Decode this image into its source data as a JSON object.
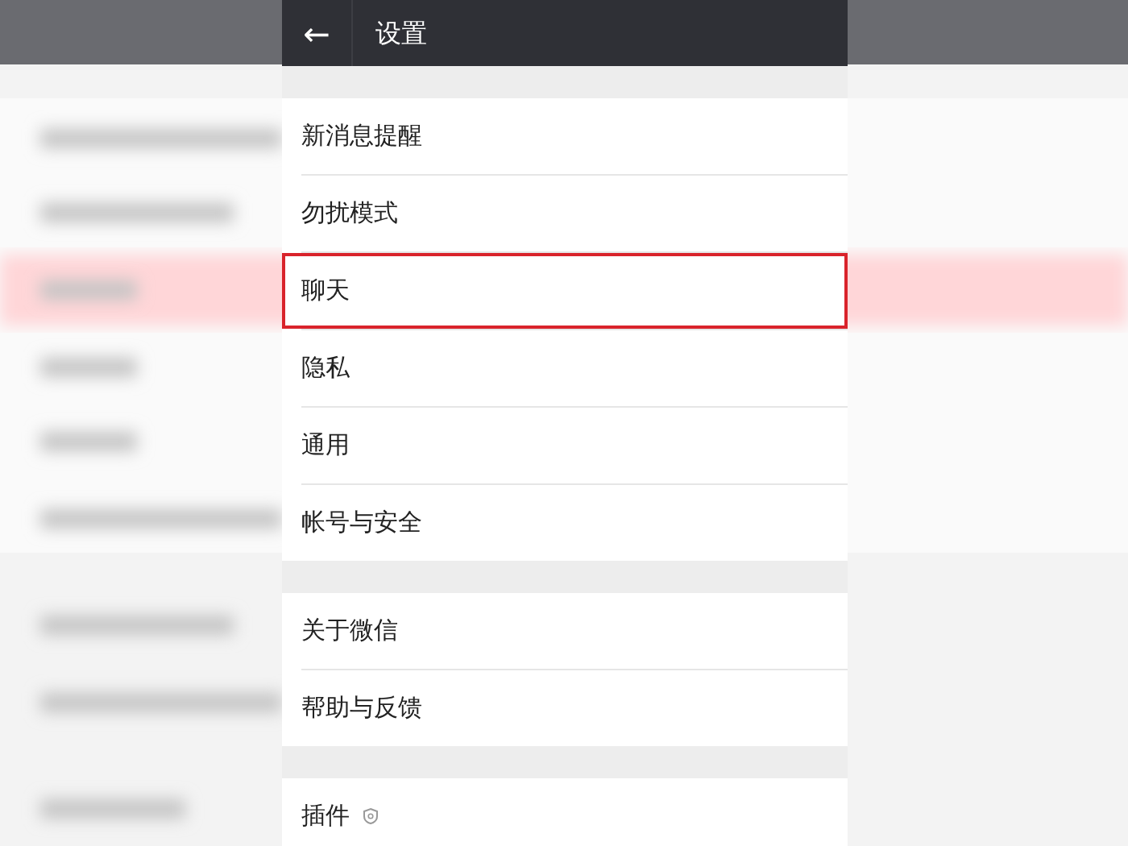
{
  "header": {
    "back": "←",
    "title": "设置"
  },
  "groups": [
    {
      "items": [
        {
          "label": "新消息提醒",
          "kind": "plain",
          "highlighted": false
        },
        {
          "label": "勿扰模式",
          "kind": "plain",
          "highlighted": false
        },
        {
          "label": "聊天",
          "kind": "plain",
          "highlighted": true
        },
        {
          "label": "隐私",
          "kind": "plain",
          "highlighted": false
        },
        {
          "label": "通用",
          "kind": "plain",
          "highlighted": false
        },
        {
          "label": "帐号与安全",
          "kind": "plain",
          "highlighted": false
        }
      ]
    },
    {
      "items": [
        {
          "label": "关于微信",
          "kind": "plain",
          "highlighted": false
        },
        {
          "label": "帮助与反馈",
          "kind": "plain",
          "highlighted": false
        }
      ]
    },
    {
      "items": [
        {
          "label": "插件",
          "kind": "shield",
          "highlighted": false
        }
      ]
    }
  ]
}
